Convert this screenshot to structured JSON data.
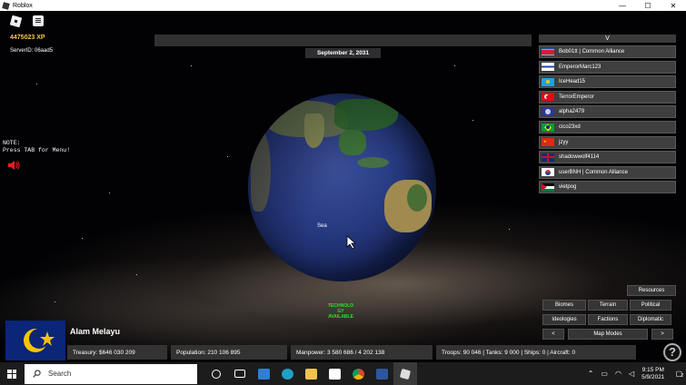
{
  "window": {
    "title": "Roblox",
    "controls": [
      "—",
      "☐",
      "✕"
    ]
  },
  "hud": {
    "xp": "4475023 XP",
    "server_id": "ServerID: 06aad5",
    "note": "NOTE:\nPress TAB for Menu!",
    "date": "September 2, 2031",
    "sea_label": "Sea",
    "tech_notice": "TECHNOLO\nGY\nAVAILABLE"
  },
  "player_list": {
    "header": "V",
    "players": [
      {
        "name": "Bob01tt  |  Common Alliance",
        "flag": "north-korea"
      },
      {
        "name": "EmperorMarc123",
        "flag": "finland"
      },
      {
        "name": "IceHead15",
        "flag": "kazakhstan"
      },
      {
        "name": "TerrorEmperor",
        "flag": "turkey"
      },
      {
        "name": "alpha2479",
        "flag": "purple-emblem"
      },
      {
        "name": "cico23xd",
        "flag": "brazil"
      },
      {
        "name": "jzyy",
        "flag": "china"
      },
      {
        "name": "shadowwolf4114",
        "flag": "united-kingdom"
      },
      {
        "name": "userBNH  |  Common Alliance",
        "flag": "south-korea"
      },
      {
        "name": "vietpog",
        "flag": "jordan"
      }
    ]
  },
  "map_controls": {
    "resources": "Resources",
    "biomes": "Biomes",
    "terrain": "Terrain",
    "political": "Political",
    "ideologies": "Ideologies",
    "factions": "Factions",
    "diplomatic": "Diplomatic",
    "prev": "<",
    "map_modes": "Map Modes",
    "next": ">"
  },
  "country": {
    "name": "Alam Melayu",
    "treasury": "Treasury:  $646 030 209",
    "population": "Population: 210 106 895",
    "manpower": "Manpower: 3 580 686  /  4 202 138",
    "troops": "Troops: 90 046  |  Tanks: 9 000  |  Ships: 0  |  Aircraft: 0"
  },
  "help_label": "?",
  "taskbar": {
    "search_placeholder": "Search",
    "time": "9:15 PM",
    "date": "5/9/2021",
    "notification_count": "2"
  },
  "colors": {
    "xp": "#ffc83a",
    "tech": "#2ee02e",
    "panel": "#3f3f3f"
  }
}
